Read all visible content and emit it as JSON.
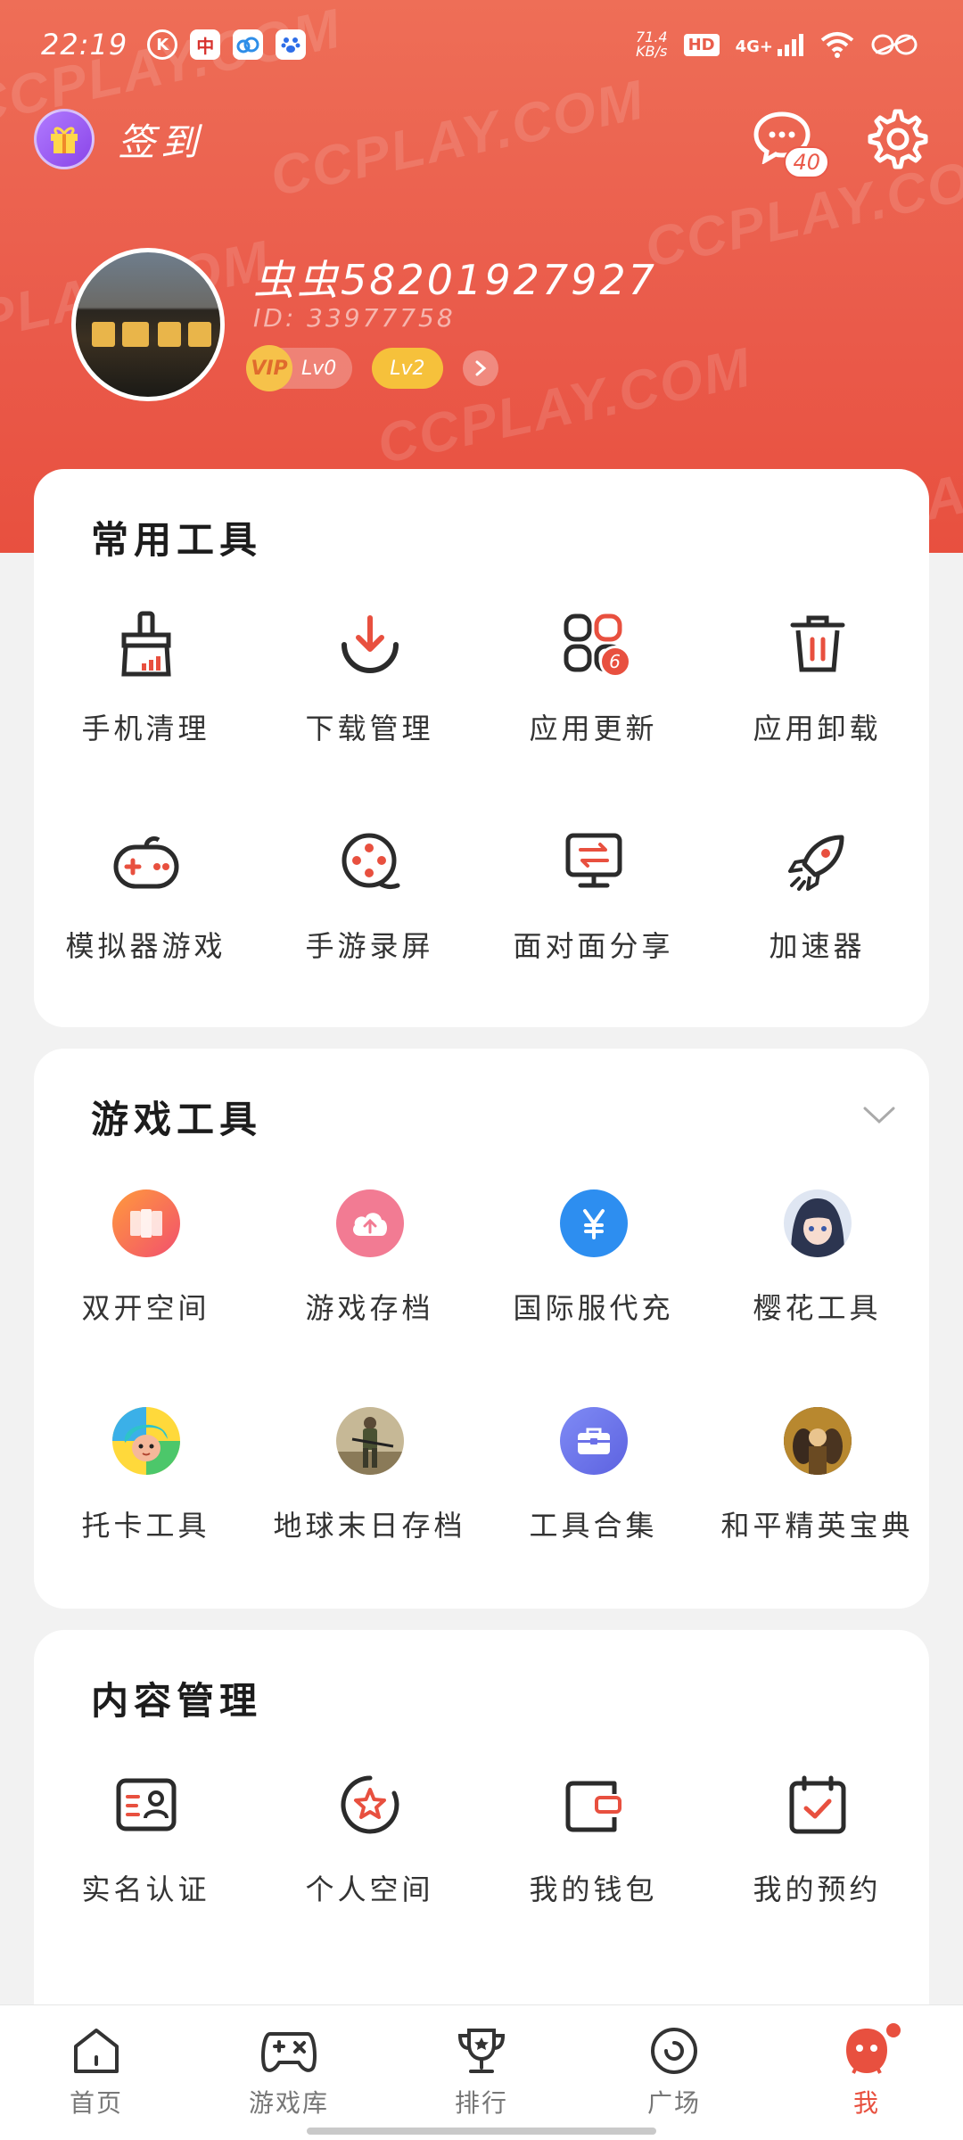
{
  "status_bar": {
    "time": "22:19",
    "net_speed_value": "71.4",
    "net_speed_unit": "KB/s",
    "hd": "HD",
    "network": "4G+"
  },
  "header": {
    "signin_label": "签到",
    "message_count": "40"
  },
  "profile": {
    "username": "虫虫58201927927",
    "user_id": "ID: 33977758",
    "vip_label": "VIP",
    "vip_level": "Lv0",
    "level": "Lv2"
  },
  "watermark_text": "CCPLAY.COM",
  "common_tools": {
    "title": "常用工具",
    "items": [
      {
        "label": "手机清理",
        "icon": "broom-icon"
      },
      {
        "label": "下载管理",
        "icon": "download-icon"
      },
      {
        "label": "应用更新",
        "icon": "app-update-icon",
        "badge": "6"
      },
      {
        "label": "应用卸载",
        "icon": "trash-icon"
      },
      {
        "label": "模拟器游戏",
        "icon": "gamepad-icon"
      },
      {
        "label": "手游录屏",
        "icon": "film-reel-icon"
      },
      {
        "label": "面对面分享",
        "icon": "share-screen-icon"
      },
      {
        "label": "加速器",
        "icon": "rocket-icon"
      }
    ]
  },
  "game_tools": {
    "title": "游戏工具",
    "items": [
      {
        "label": "双开空间",
        "icon": "dual-space-icon"
      },
      {
        "label": "游戏存档",
        "icon": "cloud-upload-icon"
      },
      {
        "label": "国际服代充",
        "icon": "yen-icon"
      },
      {
        "label": "樱花工具",
        "icon": "anime-girl-avatar-icon"
      },
      {
        "label": "托卡工具",
        "icon": "toca-avatar-icon"
      },
      {
        "label": "地球末日存档",
        "icon": "soldier-avatar-icon"
      },
      {
        "label": "工具合集",
        "icon": "toolbox-icon"
      },
      {
        "label": "和平精英宝典",
        "icon": "pubg-avatar-icon"
      }
    ]
  },
  "content_management": {
    "title": "内容管理",
    "items": [
      {
        "label": "实名认证",
        "icon": "id-card-icon"
      },
      {
        "label": "个人空间",
        "icon": "star-circle-icon"
      },
      {
        "label": "我的钱包",
        "icon": "wallet-icon"
      },
      {
        "label": "我的预约",
        "icon": "calendar-check-icon"
      }
    ]
  },
  "bottom_nav": [
    {
      "label": "首页",
      "icon": "home-icon"
    },
    {
      "label": "游戏库",
      "icon": "game-library-icon"
    },
    {
      "label": "排行",
      "icon": "trophy-icon"
    },
    {
      "label": "广场",
      "icon": "plaza-icon"
    },
    {
      "label": "我",
      "icon": "me-icon",
      "active": true
    }
  ],
  "colors": {
    "brand": "#e8503f",
    "header_top": "#ee6e57",
    "vip_gold": "#f6c24a"
  }
}
